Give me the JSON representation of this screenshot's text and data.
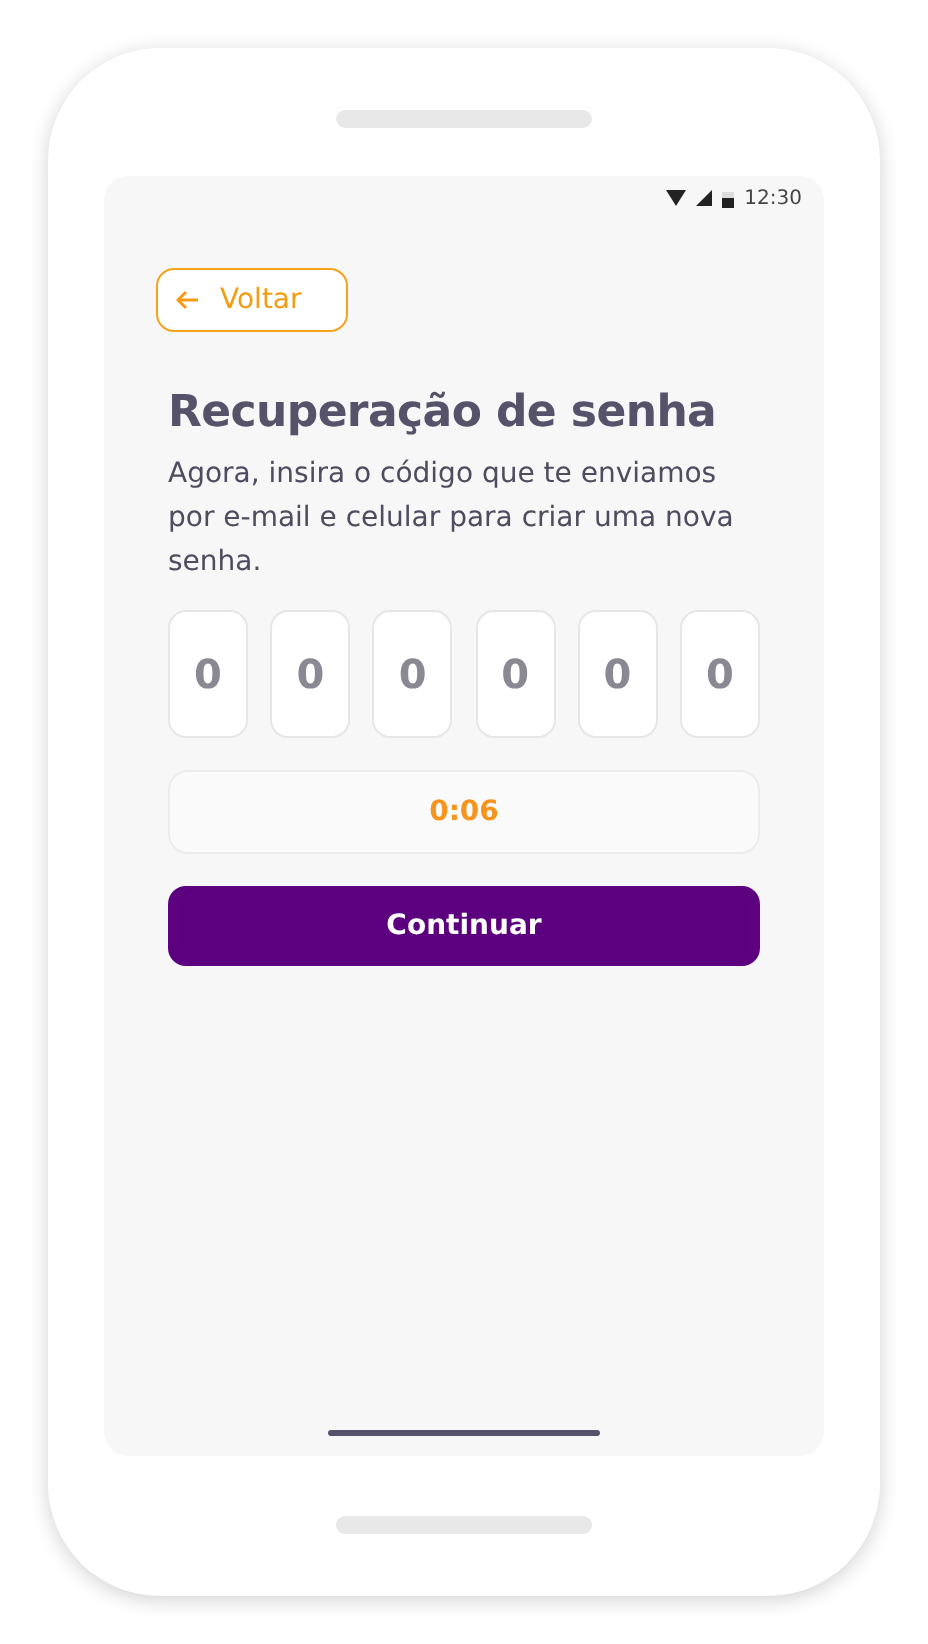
{
  "status_bar": {
    "time": "12:30"
  },
  "back_button": {
    "label": "Voltar"
  },
  "title": "Recuperação de senha",
  "description": "Agora, insira o código que te enviamos por e-mail e celular para criar uma nova senha.",
  "code_fields": [
    {
      "placeholder": "0"
    },
    {
      "placeholder": "0"
    },
    {
      "placeholder": "0"
    },
    {
      "placeholder": "0"
    },
    {
      "placeholder": "0"
    },
    {
      "placeholder": "0"
    }
  ],
  "timer": "0:06",
  "continue_button": {
    "label": "Continuar"
  }
}
